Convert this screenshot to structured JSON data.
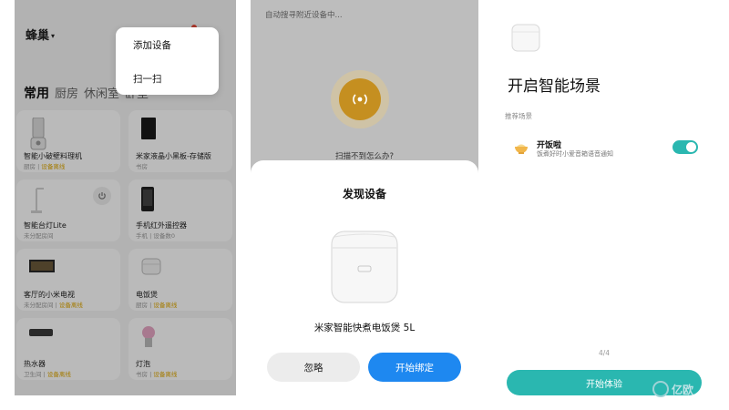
{
  "panel1": {
    "home_label": "蜂巢",
    "caret": "▾",
    "menu": {
      "items": [
        "添加设备",
        "扫一扫"
      ]
    },
    "tabs": [
      "常用",
      "厨房",
      "休闲室",
      "卧室"
    ],
    "devices": [
      {
        "name": "智能小破壁料理机",
        "room": "厨房",
        "status": "设备离线"
      },
      {
        "name": "米家液晶小黑板-存储版",
        "room": "书房",
        "status": ""
      },
      {
        "name": "智能台灯Lite",
        "room": "未分配房间",
        "status": ""
      },
      {
        "name": "手机红外遥控器",
        "room": "手机",
        "status": "设备数0"
      },
      {
        "name": "客厅的小米电视",
        "room": "未分配房间",
        "status": "设备离线"
      },
      {
        "name": "电饭煲",
        "room": "厨房",
        "status": "设备离线"
      },
      {
        "name": "热水器",
        "room": "卫生间",
        "status": "设备离线"
      },
      {
        "name": "灯泡",
        "room": "书房",
        "status": "设备离线"
      }
    ]
  },
  "panel2": {
    "top_text": "自动搜寻附近设备中...",
    "cant_find": "扫描不到怎么办?",
    "sheet_title": "发现设备",
    "device_name": "米家智能快煮电饭煲 5L",
    "ignore_label": "忽略",
    "bind_label": "开始绑定",
    "colors": {
      "bind": "#1e88f0",
      "radar": "#c58f20"
    }
  },
  "panel3": {
    "title": "开启智能场景",
    "section_label": "推荐场景",
    "scene": {
      "name": "开饭啦",
      "description": "饭煮好时小爱音箱语音通知",
      "enabled": true
    },
    "pager": "4/4",
    "start_label": "开始体验",
    "colors": {
      "accent": "#2ab7b0"
    }
  },
  "watermark": {
    "text": "亿欧"
  }
}
